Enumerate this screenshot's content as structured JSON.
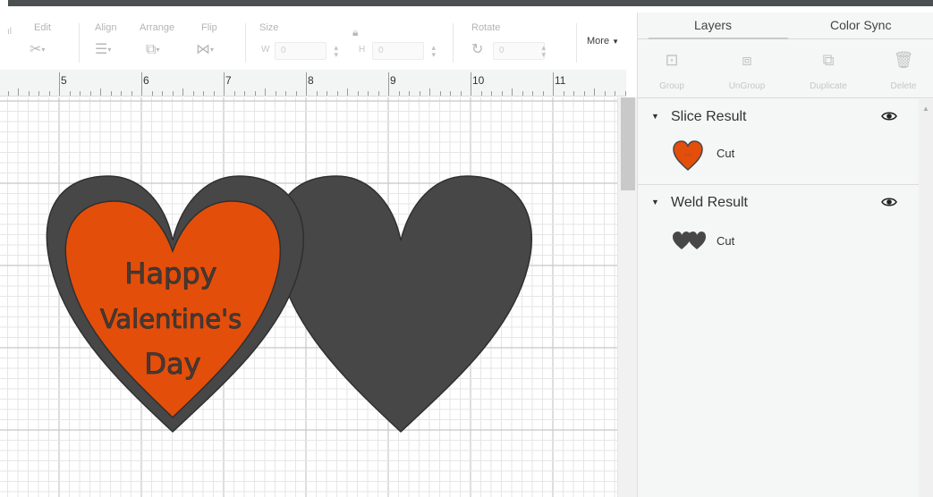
{
  "toolbar": {
    "edit_label": "Edit",
    "align_label": "Align",
    "arrange_label": "Arrange",
    "flip_label": "Flip",
    "size_label": "Size",
    "w_label": "W",
    "w_value": "0",
    "h_label": "H",
    "h_value": "0",
    "rotate_label": "Rotate",
    "rotate_value": "0",
    "more_label": "More"
  },
  "ruler": {
    "numbers": [
      "5",
      "6",
      "7",
      "8",
      "9",
      "10",
      "11"
    ]
  },
  "canvas": {
    "text_lines": [
      "Happy",
      "Valentine's",
      "Day"
    ],
    "colors": {
      "orange": "#e34e0b",
      "dark": "#474747"
    }
  },
  "panel": {
    "tabs": [
      "Layers",
      "Color Sync"
    ],
    "actions": [
      "Group",
      "UnGroup",
      "Duplicate",
      "Delete"
    ],
    "groups": [
      {
        "name": "Slice Result",
        "layer_op": "Cut",
        "thumb": "orange-heart-icon"
      },
      {
        "name": "Weld Result",
        "layer_op": "Cut",
        "thumb": "double-heart-icon"
      }
    ]
  }
}
